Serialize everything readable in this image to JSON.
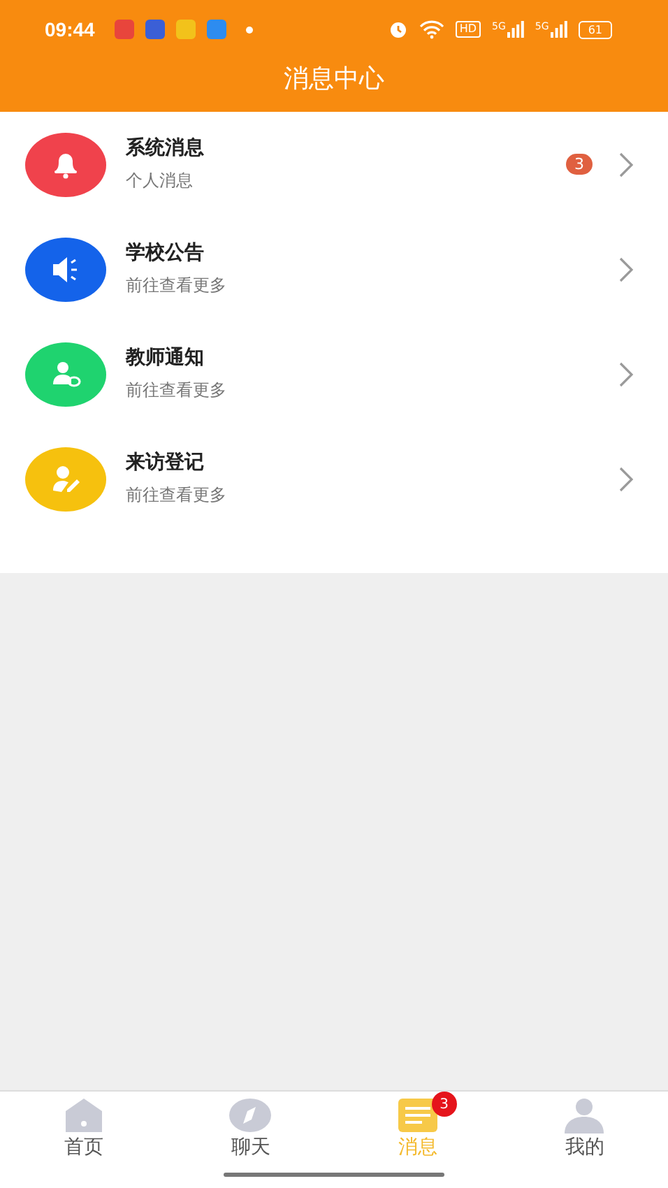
{
  "status_bar": {
    "time": "09:44",
    "app_icons": [
      {
        "color": "#e8453c"
      },
      {
        "color": "#3b5fd6"
      },
      {
        "color": "#f2c21b"
      },
      {
        "color": "#2d8cf0"
      }
    ],
    "hd": "HD",
    "networks": [
      "5G",
      "5G"
    ],
    "battery": "61"
  },
  "header": {
    "title": "消息中心"
  },
  "items": [
    {
      "kind": "bell",
      "color": "#f0424c",
      "title": "系统消息",
      "subtitle": "个人消息",
      "badge": "3"
    },
    {
      "kind": "speaker",
      "color": "#1463ea",
      "title": "学校公告",
      "subtitle": "前往查看更多"
    },
    {
      "kind": "teacher",
      "color": "#1fd36f",
      "title": "教师通知",
      "subtitle": "前往查看更多"
    },
    {
      "kind": "visitor",
      "color": "#f6c10e",
      "title": "来访登记",
      "subtitle": "前往查看更多"
    }
  ],
  "tabs": [
    {
      "kind": "home",
      "label": "首页",
      "selected": false
    },
    {
      "kind": "compass",
      "label": "聊天",
      "selected": false
    },
    {
      "kind": "list",
      "label": "消息",
      "selected": true,
      "badge": "3"
    },
    {
      "kind": "person",
      "label": "我的",
      "selected": false
    }
  ]
}
